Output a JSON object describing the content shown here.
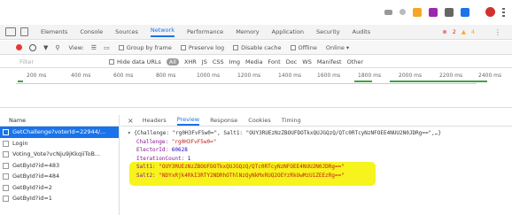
{
  "devtools": {
    "tabs": [
      "Elements",
      "Console",
      "Sources",
      "Network",
      "Performance",
      "Memory",
      "Application",
      "Security",
      "Audits"
    ],
    "active_tab": "Network",
    "error_count": "2",
    "warning_count": "4"
  },
  "toolbar": {
    "view_label": "View:",
    "group_by_frame": "Group by frame",
    "preserve_log": "Preserve log",
    "disable_cache": "Disable cache",
    "offline": "Offline",
    "online": "Online"
  },
  "filter": {
    "placeholder": "Filter",
    "hide_data_urls": "Hide data URLs",
    "all": "All",
    "types": [
      "XHR",
      "JS",
      "CSS",
      "Img",
      "Media",
      "Font",
      "Doc",
      "WS",
      "Manifest",
      "Other"
    ]
  },
  "timeline": {
    "ticks": [
      "200 ms",
      "400 ms",
      "600 ms",
      "800 ms",
      "1000 ms",
      "1200 ms",
      "1400 ms",
      "1600 ms",
      "1800 ms",
      "2000 ms",
      "2200 ms",
      "2400 ms"
    ]
  },
  "requests": {
    "header": "Name",
    "items": [
      "GetChallenge?voterId=22944/...",
      "Login",
      "Voting_Vote?vcNju9jKkqiiToB...",
      "GetById?id=483",
      "GetById?id=484",
      "GetById?id=2",
      "GetById?id=1"
    ]
  },
  "detail": {
    "tabs": [
      "Headers",
      "Preview",
      "Response",
      "Cookies",
      "Timing"
    ],
    "active_tab": "Preview",
    "lines": {
      "summary": "▾ {Challenge: \"rg0H3FvF5w0=\", Salt1: \"OUY3RUEzNzZBOUFDOTkxQUJGQzQ/QTc0RTcyNzNFOEE4NUU2N0JDRg==\",…}",
      "challenge_key": "Challenge: ",
      "challenge_val": "\"rg0H3FvF5w0=\"",
      "elector_key": "ElectorId: ",
      "elector_val": "60628",
      "iter_key": "IterationCount: ",
      "iter_val": "1",
      "salt1_key": "Salt1: ",
      "salt1_val": "\"OUY3RUEzNzZBOUFDOTkxQUJGQzQ/QTc0RTcyNzNFOEE4NUU2N0JDRg==\"",
      "salt2_key": "Salt2: ",
      "salt2_val": "\"NDYxRjk4RkI3RTY2NDRhOThlNzQyNkMxRUQ2OEYzRkUwMzU1ZEEzRg==\""
    }
  }
}
